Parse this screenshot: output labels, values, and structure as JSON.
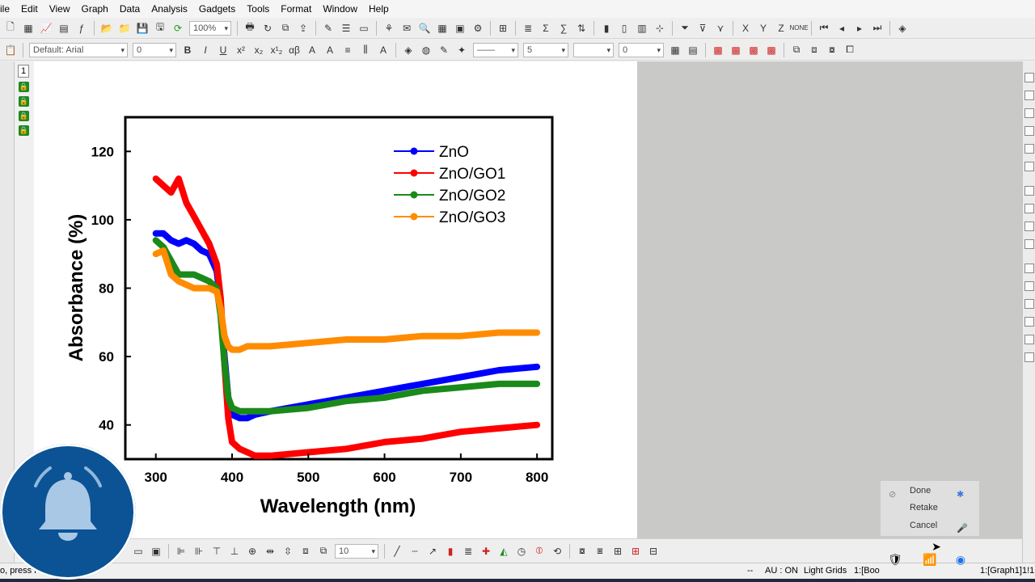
{
  "menu": [
    "ile",
    "Edit",
    "View",
    "Graph",
    "Data",
    "Analysis",
    "Gadgets",
    "Tools",
    "Format",
    "Window",
    "Help"
  ],
  "toolbar": {
    "zoom": "100%",
    "font_name": "Default: Arial",
    "font_size": "0",
    "line_width": "5",
    "fill_value": "0",
    "bottom_size": "10"
  },
  "layers": {
    "layer_number": "1"
  },
  "chart_data": {
    "type": "scatter",
    "title": "",
    "xlabel": "Wavelength (nm)",
    "ylabel": "Absorbance (%)",
    "xlim": [
      260,
      820
    ],
    "ylim": [
      30,
      130
    ],
    "x_ticks": [
      "300",
      "400",
      "500",
      "600",
      "700",
      "800"
    ],
    "y_ticks": [
      "40",
      "60",
      "80",
      "100",
      "120"
    ],
    "legend_position": "top-right",
    "series": [
      {
        "name": "ZnO",
        "color": "#0000ff",
        "x": [
          300,
          310,
          320,
          330,
          340,
          350,
          360,
          370,
          380,
          385,
          390,
          395,
          400,
          410,
          420,
          430,
          450,
          500,
          550,
          600,
          650,
          700,
          750,
          800
        ],
        "y": [
          96,
          96,
          94,
          93,
          94,
          93,
          91,
          90,
          85,
          75,
          60,
          48,
          43,
          42,
          42,
          43,
          44,
          46,
          48,
          50,
          52,
          54,
          56,
          57
        ]
      },
      {
        "name": "ZnO/GO1",
        "color": "#ff0000",
        "x": [
          300,
          310,
          320,
          330,
          340,
          350,
          360,
          370,
          380,
          385,
          390,
          395,
          400,
          410,
          420,
          430,
          450,
          500,
          550,
          600,
          650,
          700,
          750,
          800
        ],
        "y": [
          112,
          110,
          108,
          112,
          105,
          101,
          97,
          93,
          87,
          77,
          58,
          42,
          35,
          33,
          32,
          31,
          31,
          32,
          33,
          35,
          36,
          38,
          39,
          40
        ]
      },
      {
        "name": "ZnO/GO2",
        "color": "#1a8a1a",
        "x": [
          300,
          310,
          320,
          330,
          340,
          350,
          360,
          370,
          380,
          385,
          390,
          395,
          400,
          410,
          420,
          430,
          450,
          500,
          550,
          600,
          650,
          700,
          750,
          800
        ],
        "y": [
          94,
          92,
          88,
          84,
          84,
          84,
          83,
          82,
          80,
          72,
          58,
          48,
          45,
          44,
          44,
          44,
          44,
          45,
          47,
          48,
          50,
          51,
          52,
          52
        ]
      },
      {
        "name": "ZnO/GO3",
        "color": "#ff8c00",
        "x": [
          300,
          310,
          320,
          330,
          340,
          350,
          360,
          370,
          380,
          385,
          390,
          395,
          400,
          410,
          420,
          430,
          450,
          500,
          550,
          600,
          650,
          700,
          750,
          800
        ],
        "y": [
          90,
          91,
          84,
          82,
          81,
          80,
          80,
          80,
          79,
          74,
          66,
          63,
          62,
          62,
          63,
          63,
          63,
          64,
          65,
          65,
          66,
          66,
          67,
          67
        ]
      }
    ]
  },
  "popup": {
    "options": [
      "Done",
      "Retake",
      "Cancel"
    ]
  },
  "status": {
    "left_text": "o, press F",
    "dash": "--",
    "au": "AU : ON",
    "grids": "Light Grids",
    "book": "1:[Boo",
    "graph_ref": "1:[Graph1]1!1"
  },
  "colors": {
    "bell_bg": "#0b5394",
    "page_bg": "#ffffff",
    "workspace_gray": "#c9c9c7"
  }
}
